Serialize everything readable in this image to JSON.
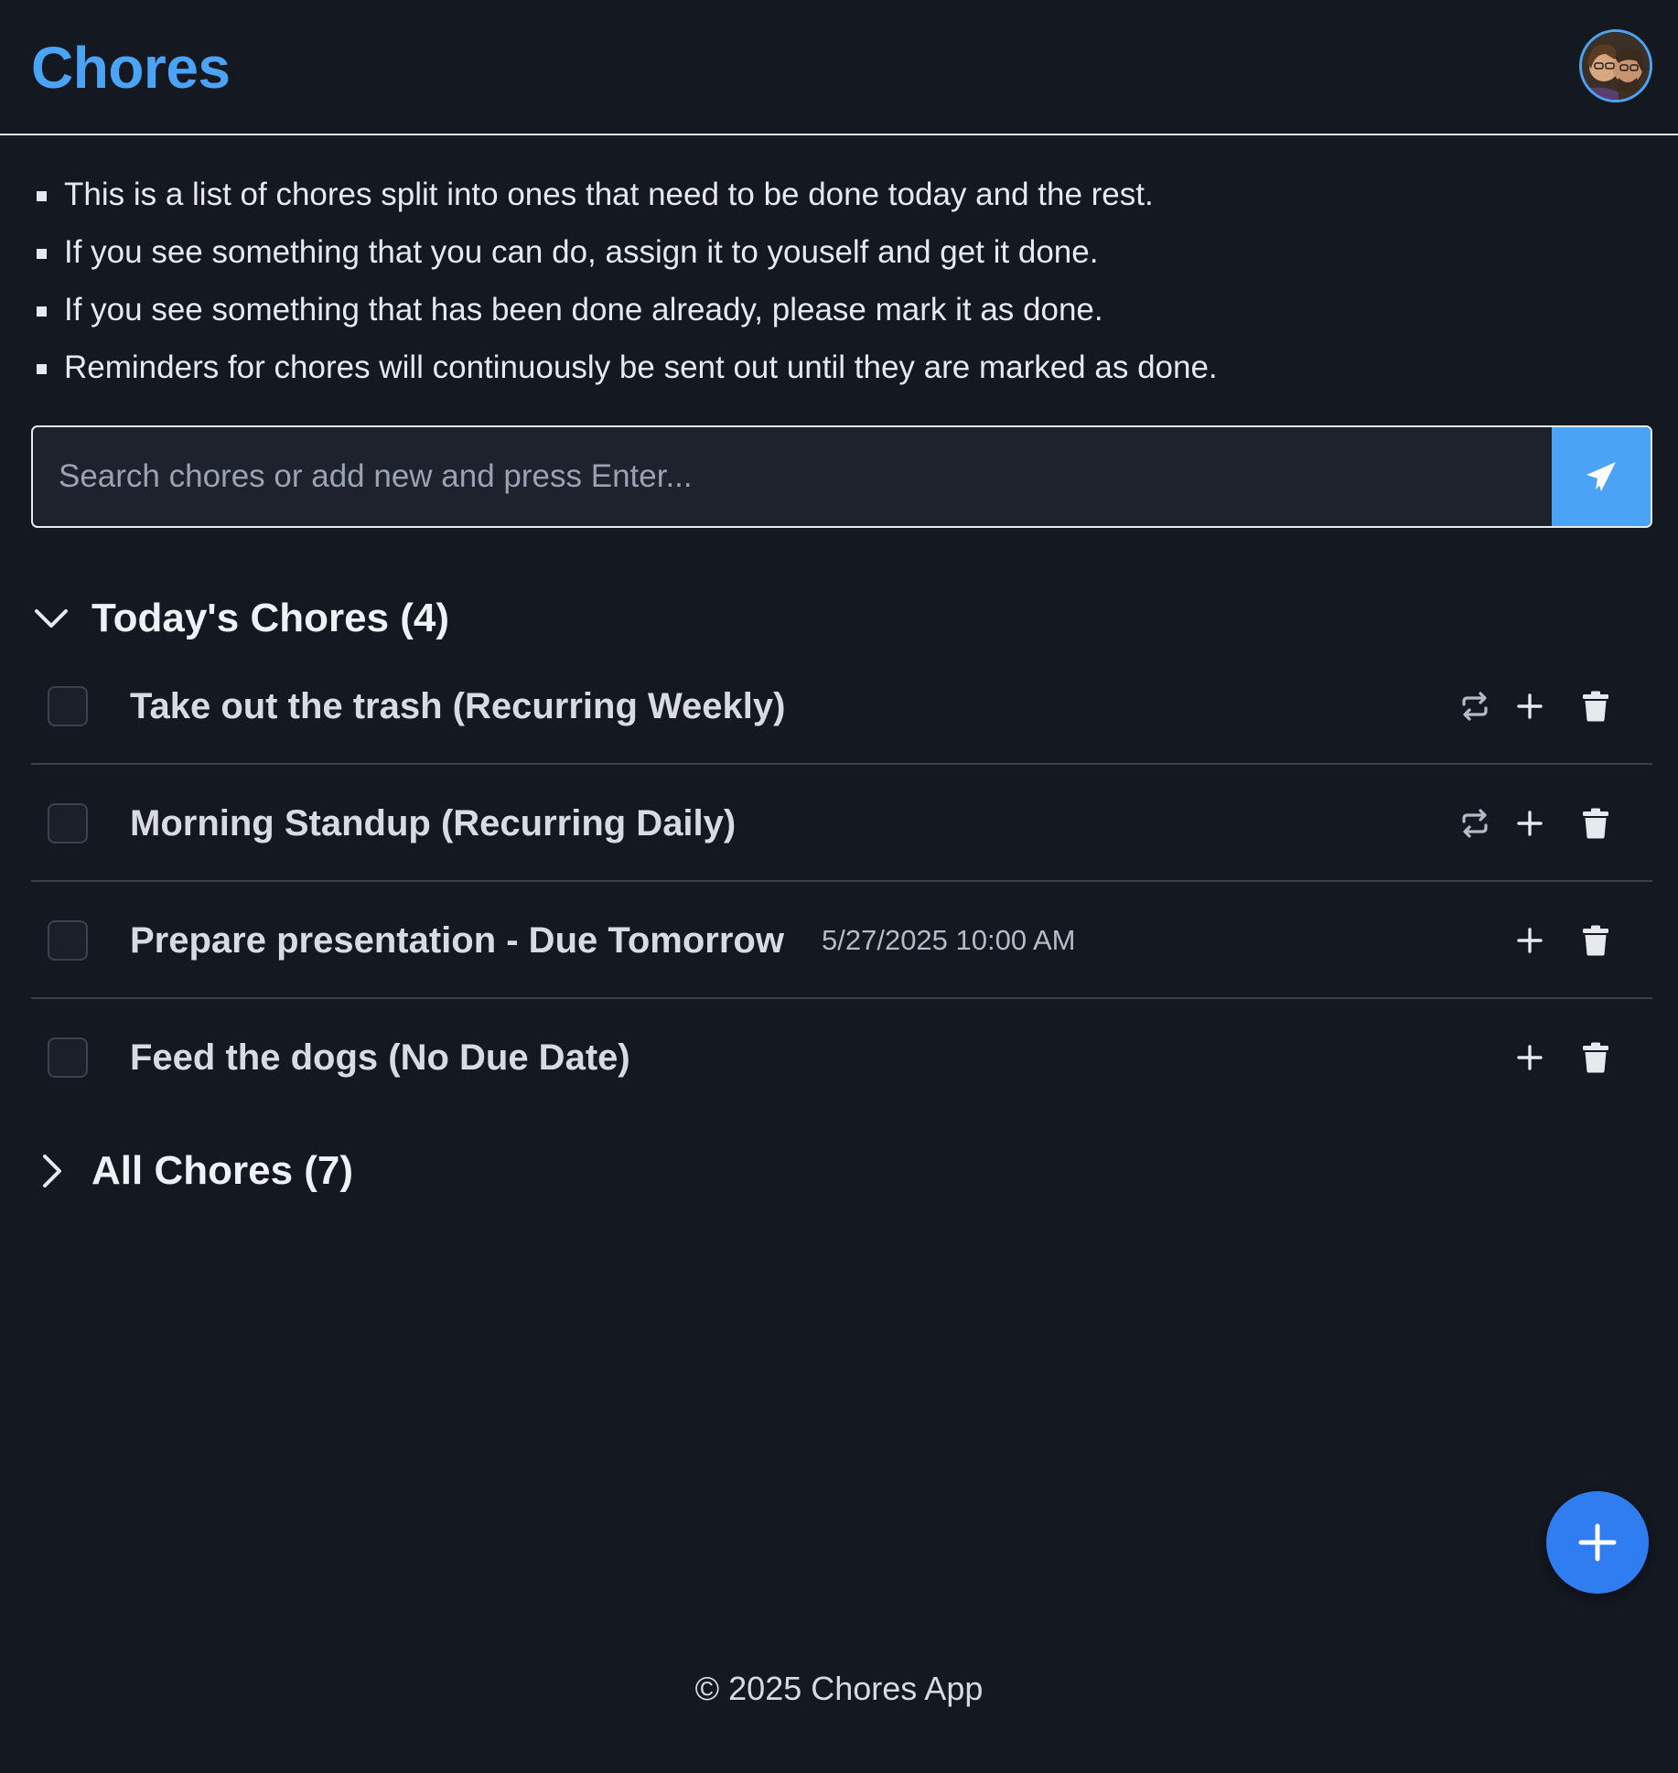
{
  "header": {
    "title": "Chores",
    "avatar_icon": "user-avatar-icon"
  },
  "info": {
    "items": [
      "This is a list of chores split into ones that need to be done today and the rest.",
      "If you see something that you can do, assign it to youself and get it done.",
      "If you see something that has been done already, please mark it as done.",
      "Reminders for chores will continuously be sent out until they are marked as done."
    ]
  },
  "search": {
    "placeholder": "Search chores or add new and press Enter...",
    "value": "",
    "submit_icon": "paper-plane-icon"
  },
  "today": {
    "title": "Today's Chores (4)",
    "expanded": true,
    "chores": [
      {
        "title": "Take out the trash (Recurring Weekly)",
        "due": "",
        "recurring": true,
        "done": false
      },
      {
        "title": "Morning Standup (Recurring Daily)",
        "due": "",
        "recurring": true,
        "done": false
      },
      {
        "title": "Prepare presentation - Due Tomorrow",
        "due": "5/27/2025 10:00 AM",
        "recurring": false,
        "done": false
      },
      {
        "title": "Feed the dogs (No Due Date)",
        "due": "",
        "recurring": false,
        "done": false
      }
    ]
  },
  "all": {
    "title": "All Chores (7)",
    "expanded": false
  },
  "fab": {
    "icon": "plus-icon"
  },
  "footer": {
    "text": "© 2025 Chores App"
  },
  "colors": {
    "background": "#141821",
    "accent": "#4aa3f5",
    "fab": "#2f7df0",
    "text": "#e6e9ee",
    "muted": "#b6bcc7"
  }
}
